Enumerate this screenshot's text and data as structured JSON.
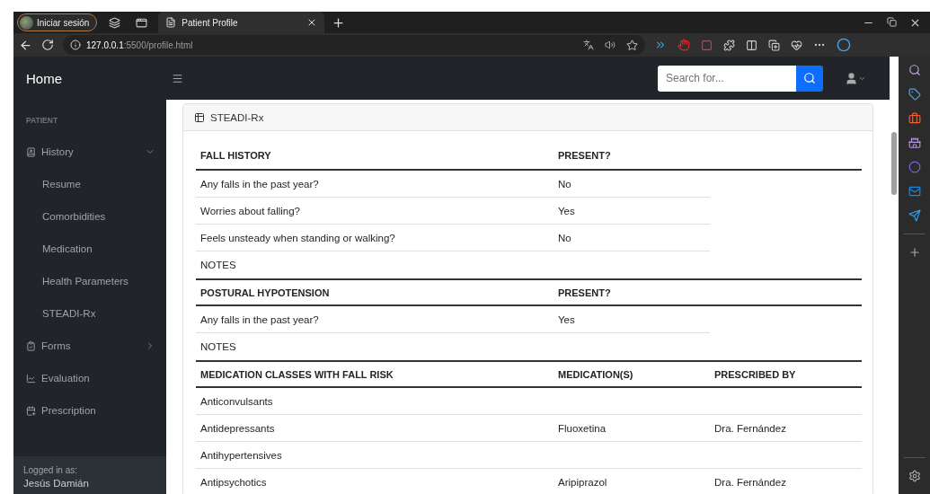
{
  "browser": {
    "profile_button": "Iniciar sesión",
    "tabs": [
      {
        "title": "Patient Profile",
        "selected": true
      }
    ],
    "address": {
      "host": "127.0.0.1",
      "path": ":5500/profile.html"
    }
  },
  "topbar": {
    "brand": "Home",
    "search": {
      "placeholder": "Search for..."
    }
  },
  "sidebar": {
    "heading": "PATIENT",
    "items": [
      {
        "kind": "group",
        "label": "History",
        "expanded": true,
        "children": [
          "Resume",
          "Comorbidities",
          "Medication",
          "Health Parameters",
          "STEADI-Rx"
        ]
      },
      {
        "kind": "group",
        "label": "Forms",
        "expanded": false
      },
      {
        "kind": "link",
        "label": "Evaluation"
      },
      {
        "kind": "link",
        "label": "Prescription"
      }
    ],
    "footer": {
      "caption": "Logged in as:",
      "user": "Jesús Damián"
    }
  },
  "card": {
    "title": "STEADI-Rx",
    "sections": [
      {
        "columns": [
          "FALL HISTORY",
          "PRESENT?"
        ],
        "rows": [
          [
            "Any falls in the past year?",
            "No"
          ],
          [
            "Worries about falling?",
            "Yes"
          ],
          [
            "Feels unsteady when standing or walking?",
            "No"
          ],
          [
            "NOTES"
          ]
        ]
      },
      {
        "columns": [
          "POSTURAL HYPOTENSION",
          "PRESENT?"
        ],
        "rows": [
          [
            "Any falls in the past year?",
            "Yes"
          ],
          [
            "NOTES"
          ]
        ]
      },
      {
        "columns": [
          "MEDICATION CLASSES WITH FALL RISK",
          "MEDICATION(S)",
          "PRESCRIBED BY"
        ],
        "rows": [
          [
            "Anticonvulsants"
          ],
          [
            "Antidepressants",
            "Fluoxetina",
            "Dra. Fernández"
          ],
          [
            "Antihypertensives"
          ],
          [
            "Antipsychotics",
            "Aripiprazol",
            "Dra. Fernández"
          ]
        ]
      }
    ]
  }
}
